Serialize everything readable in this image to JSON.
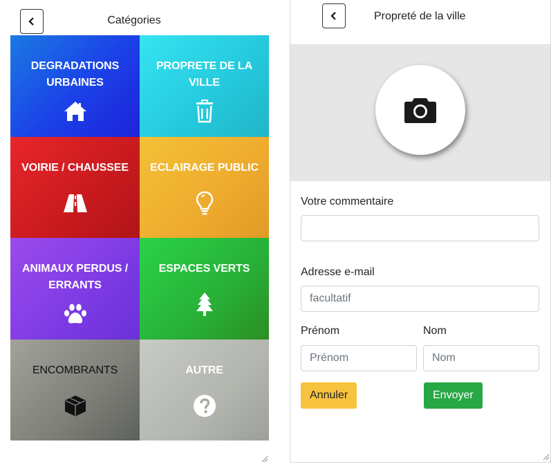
{
  "left": {
    "title": "Catégories",
    "tiles": [
      {
        "label": "DEGRADATIONS URBAINES",
        "icon": "house-icon"
      },
      {
        "label": "PROPRETE DE LA VILLE",
        "icon": "trash-icon"
      },
      {
        "label": "VOIRIE / CHAUSSEE",
        "icon": "road-icon"
      },
      {
        "label": "ECLAIRAGE PUBLIC",
        "icon": "lightbulb-icon"
      },
      {
        "label": "ANIMAUX PERDUS / ERRANTS",
        "icon": "paw-icon"
      },
      {
        "label": "ESPACES VERTS",
        "icon": "tree-icon"
      },
      {
        "label": "ENCOMBRANTS",
        "icon": "box-icon"
      },
      {
        "label": "AUTRE",
        "icon": "question-circle-icon"
      }
    ],
    "tile_colors": [
      "#1b40e8",
      "#24c8dc",
      "#c81a1e",
      "#eeab2e",
      "#7d3ae4",
      "#28b037",
      "#7d7f78",
      "#b3b6af"
    ]
  },
  "right": {
    "title": "Propreté de la ville",
    "camera_icon": "camera-icon",
    "comment_label": "Votre commentaire",
    "comment_value": "",
    "email_label": "Adresse e-mail",
    "email_placeholder": "facultatif",
    "firstname_label": "Prénom",
    "firstname_placeholder": "Prénom",
    "lastname_label": "Nom",
    "lastname_placeholder": "Nom",
    "cancel_label": "Annuler",
    "send_label": "Envoyer",
    "cancel_color": "#f7c23d",
    "send_color": "#28a745"
  }
}
